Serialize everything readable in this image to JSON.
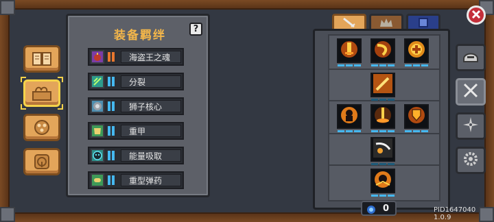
{
  "bond_panel": {
    "title": "装备羁绊",
    "help_label": "?",
    "bonds": [
      {
        "name": "海盗王之魂",
        "icon": "skull-bomb-icon",
        "icon_color": "#7b3da6"
      },
      {
        "name": "分裂",
        "icon": "split-arrows-icon",
        "icon_color": "#2e9c8c"
      },
      {
        "name": "狮子核心",
        "icon": "lion-core-icon",
        "icon_color": "#4f8fb0"
      },
      {
        "name": "重甲",
        "icon": "heavy-armor-icon",
        "icon_color": "#3e9a58"
      },
      {
        "name": "能量吸取",
        "icon": "energy-drain-icon",
        "icon_color": "#2f8c86"
      },
      {
        "name": "重型弹药",
        "icon": "heavy-ammo-icon",
        "icon_color": "#3e9a58"
      }
    ]
  },
  "left_categories": [
    {
      "name": "book-icon",
      "selected": false
    },
    {
      "name": "swirl-map-icon",
      "selected": true
    },
    {
      "name": "dots-badge-icon",
      "selected": false
    },
    {
      "name": "wheel-badge-icon",
      "selected": false
    }
  ],
  "skill_tabs": [
    {
      "name": "sword-tab-icon",
      "active": true
    },
    {
      "name": "crown-tab-icon",
      "active": false
    },
    {
      "name": "scroll-tab-icon",
      "active": false
    }
  ],
  "right_buttons": [
    {
      "name": "helmet-icon",
      "selected": false
    },
    {
      "name": "crossed-swords-icon",
      "selected": true
    },
    {
      "name": "compass-star-icon",
      "selected": false
    },
    {
      "name": "gear-icon",
      "selected": false
    }
  ],
  "currency": {
    "value": "0",
    "icon": "gem-icon"
  },
  "version_text": "PID1647040 1.0.9",
  "colors": {
    "accent_gold": "#f3b64a",
    "bar_blue": "#45b8f0",
    "wood": "#7a4a24"
  }
}
